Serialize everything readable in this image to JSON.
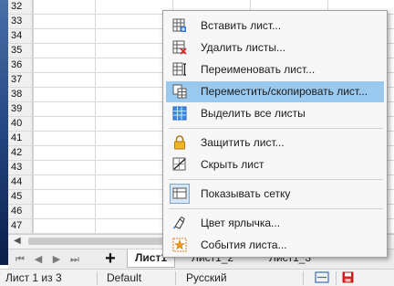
{
  "grid": {
    "rows": [
      "32",
      "33",
      "34",
      "35",
      "36",
      "37",
      "38",
      "39",
      "40",
      "41",
      "42",
      "43",
      "44",
      "45",
      "46",
      "47"
    ]
  },
  "context_menu": {
    "items": [
      {
        "label": "Вставить лист...",
        "icon": "insert-sheet-icon",
        "highlighted": false
      },
      {
        "label": "Удалить листы...",
        "icon": "delete-sheets-icon",
        "highlighted": false
      },
      {
        "label": "Переименовать лист...",
        "icon": "rename-sheet-icon",
        "highlighted": false
      },
      {
        "label": "Переместить/скопировать лист...",
        "icon": "move-copy-sheet-icon",
        "highlighted": true
      },
      {
        "label": "Выделить все листы",
        "icon": "select-all-sheets-icon",
        "highlighted": false
      },
      {
        "label": "Защитить лист...",
        "icon": "lock-icon",
        "highlighted": false
      },
      {
        "label": "Скрыть лист",
        "icon": "hide-sheet-icon",
        "highlighted": false
      },
      {
        "label": "Показывать сетку",
        "icon": "show-grid-icon",
        "highlighted": false
      },
      {
        "label": "Цвет ярлычка...",
        "icon": "tab-color-icon",
        "highlighted": false
      },
      {
        "label": "События листа...",
        "icon": "sheet-events-icon",
        "highlighted": false
      }
    ]
  },
  "tabs": {
    "add_label": "+",
    "sheets": [
      "Лист1",
      "Лист1_2",
      "Лист1_3"
    ],
    "active_index": 0
  },
  "status": {
    "sheet_info": "Лист 1 из 3",
    "page_style": "Default",
    "language": "Русский"
  },
  "colors": {
    "menu_highlight": "#99c9ef",
    "menu_background": "#f7f7f7",
    "grid_line": "#d9d9d9"
  }
}
